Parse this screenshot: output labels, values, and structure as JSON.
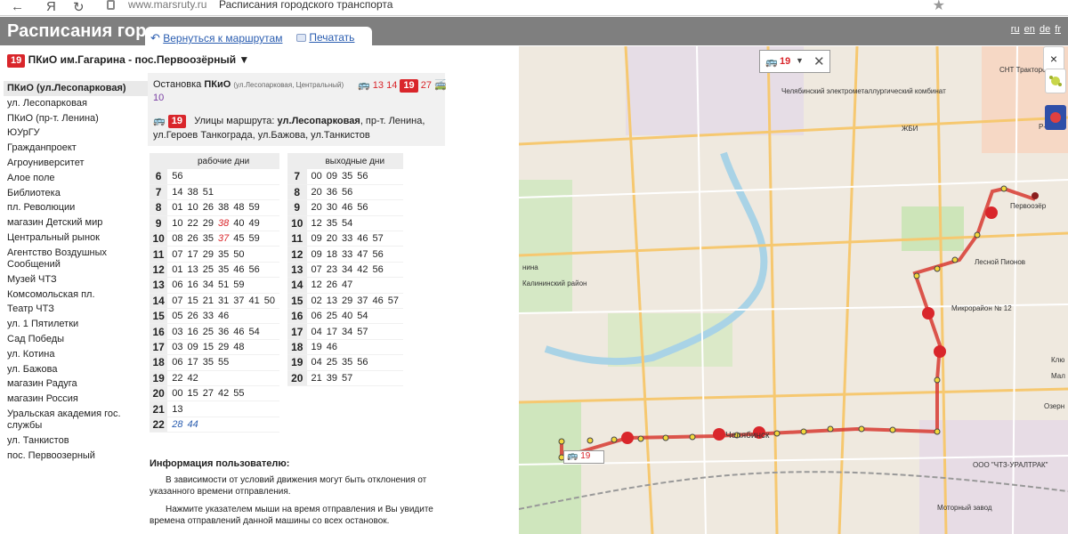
{
  "browser": {
    "domain": "www.marsruty.ru",
    "page_title": "Расписания городского транспорта"
  },
  "header": {
    "site_title": "Расписания гор",
    "languages": [
      "ru",
      "en",
      "de",
      "fr"
    ]
  },
  "tabs": {
    "back_label": "Вернуться к маршрутам",
    "print_label": "Печатать"
  },
  "route": {
    "number": "19",
    "title": "ПКиО им.Гагарина - пос.Первоозёрный ▼"
  },
  "stops": [
    "ПКиО (ул.Лесопарковая)",
    "ул. Лесопарковая",
    "ПКиО (пр-т. Ленина)",
    "ЮУрГУ",
    "Гражданпроект",
    "Агроуниверситет",
    "Алое поле",
    "Библиотека",
    "пл. Революции",
    "магазин Детский мир",
    "Центральный рынок",
    "Агентство Воздушных Сообщений",
    "Музей ЧТЗ",
    "Комсомольская пл.",
    "Театр ЧТЗ",
    "ул. 1 Пятилетки",
    "Сад Победы",
    "ул. Котина",
    "ул. Бажова",
    "магазин Радуга",
    "магазин Россия",
    "Уральская академия гос. службы",
    "ул. Танкистов",
    "пос. Первоозерный"
  ],
  "stop_info": {
    "label": "Остановка",
    "name": "ПКиО",
    "detail": "(ул.Лесопарковая, Центральный)",
    "bus_routes": [
      "13",
      "14"
    ],
    "current_route": "19",
    "bus_routes_after": [
      "27"
    ],
    "trolley_routes": [
      "10"
    ],
    "streets_label": "Улицы маршрута:",
    "streets_bold": "ул.Лесопарковая",
    "streets_rest": ", пр-т. Ленина, ул.Героев Танкограда, ул.Бажова, ул.Танкистов"
  },
  "weekday": {
    "title": "рабочие дни",
    "rows": [
      {
        "h": "6",
        "m": [
          {
            "v": "56"
          }
        ]
      },
      {
        "h": "7",
        "m": [
          {
            "v": "14"
          },
          {
            "v": "38"
          },
          {
            "v": "51"
          }
        ]
      },
      {
        "h": "8",
        "m": [
          {
            "v": "01"
          },
          {
            "v": "10"
          },
          {
            "v": "26"
          },
          {
            "v": "38"
          },
          {
            "v": "48"
          },
          {
            "v": "59"
          }
        ]
      },
      {
        "h": "9",
        "m": [
          {
            "v": "10"
          },
          {
            "v": "22"
          },
          {
            "v": "29"
          },
          {
            "v": "38",
            "c": "r"
          },
          {
            "v": "40"
          },
          {
            "v": "49"
          }
        ]
      },
      {
        "h": "10",
        "m": [
          {
            "v": "08"
          },
          {
            "v": "26"
          },
          {
            "v": "35"
          },
          {
            "v": "37",
            "c": "r"
          },
          {
            "v": "45"
          },
          {
            "v": "59"
          }
        ]
      },
      {
        "h": "11",
        "m": [
          {
            "v": "07"
          },
          {
            "v": "17"
          },
          {
            "v": "29"
          },
          {
            "v": "35"
          },
          {
            "v": "50"
          }
        ]
      },
      {
        "h": "12",
        "m": [
          {
            "v": "01"
          },
          {
            "v": "13"
          },
          {
            "v": "25"
          },
          {
            "v": "35"
          },
          {
            "v": "46"
          },
          {
            "v": "56"
          }
        ]
      },
      {
        "h": "13",
        "m": [
          {
            "v": "06"
          },
          {
            "v": "16"
          },
          {
            "v": "34"
          },
          {
            "v": "51"
          },
          {
            "v": "59"
          }
        ]
      },
      {
        "h": "14",
        "m": [
          {
            "v": "07"
          },
          {
            "v": "15"
          },
          {
            "v": "21"
          },
          {
            "v": "31"
          },
          {
            "v": "37"
          },
          {
            "v": "41"
          },
          {
            "v": "50"
          }
        ]
      },
      {
        "h": "15",
        "m": [
          {
            "v": "05"
          },
          {
            "v": "26"
          },
          {
            "v": "33"
          },
          {
            "v": "46"
          }
        ]
      },
      {
        "h": "16",
        "m": [
          {
            "v": "03"
          },
          {
            "v": "16"
          },
          {
            "v": "25"
          },
          {
            "v": "36"
          },
          {
            "v": "46"
          },
          {
            "v": "54"
          }
        ]
      },
      {
        "h": "17",
        "m": [
          {
            "v": "03"
          },
          {
            "v": "09"
          },
          {
            "v": "15"
          },
          {
            "v": "29"
          },
          {
            "v": "48"
          }
        ]
      },
      {
        "h": "18",
        "m": [
          {
            "v": "06"
          },
          {
            "v": "17"
          },
          {
            "v": "35"
          },
          {
            "v": "55"
          }
        ]
      },
      {
        "h": "19",
        "m": [
          {
            "v": "22"
          },
          {
            "v": "42"
          }
        ]
      },
      {
        "h": "20",
        "m": [
          {
            "v": "00"
          },
          {
            "v": "15"
          },
          {
            "v": "27"
          },
          {
            "v": "42"
          },
          {
            "v": "55"
          }
        ]
      },
      {
        "h": "21",
        "m": [
          {
            "v": "13"
          }
        ]
      },
      {
        "h": "22",
        "m": [
          {
            "v": "28",
            "c": "b"
          },
          {
            "v": "44",
            "c": "b"
          }
        ]
      }
    ]
  },
  "weekend": {
    "title": "выходные дни",
    "rows": [
      {
        "h": "7",
        "m": [
          {
            "v": "00"
          },
          {
            "v": "09"
          },
          {
            "v": "35"
          },
          {
            "v": "56"
          }
        ]
      },
      {
        "h": "8",
        "m": [
          {
            "v": "20"
          },
          {
            "v": "36"
          },
          {
            "v": "56"
          }
        ]
      },
      {
        "h": "9",
        "m": [
          {
            "v": "20"
          },
          {
            "v": "30"
          },
          {
            "v": "46"
          },
          {
            "v": "56"
          }
        ]
      },
      {
        "h": "10",
        "m": [
          {
            "v": "12"
          },
          {
            "v": "35"
          },
          {
            "v": "54"
          }
        ]
      },
      {
        "h": "11",
        "m": [
          {
            "v": "09"
          },
          {
            "v": "20"
          },
          {
            "v": "33"
          },
          {
            "v": "46"
          },
          {
            "v": "57"
          }
        ]
      },
      {
        "h": "12",
        "m": [
          {
            "v": "09"
          },
          {
            "v": "18"
          },
          {
            "v": "33"
          },
          {
            "v": "47"
          },
          {
            "v": "56"
          }
        ]
      },
      {
        "h": "13",
        "m": [
          {
            "v": "07"
          },
          {
            "v": "23"
          },
          {
            "v": "34"
          },
          {
            "v": "42"
          },
          {
            "v": "56"
          }
        ]
      },
      {
        "h": "14",
        "m": [
          {
            "v": "12"
          },
          {
            "v": "26"
          },
          {
            "v": "47"
          }
        ]
      },
      {
        "h": "15",
        "m": [
          {
            "v": "02"
          },
          {
            "v": "13"
          },
          {
            "v": "29"
          },
          {
            "v": "37"
          },
          {
            "v": "46"
          },
          {
            "v": "57"
          }
        ]
      },
      {
        "h": "16",
        "m": [
          {
            "v": "06"
          },
          {
            "v": "25"
          },
          {
            "v": "40"
          },
          {
            "v": "54"
          }
        ]
      },
      {
        "h": "17",
        "m": [
          {
            "v": "04"
          },
          {
            "v": "17"
          },
          {
            "v": "34"
          },
          {
            "v": "57"
          }
        ]
      },
      {
        "h": "18",
        "m": [
          {
            "v": "19"
          },
          {
            "v": "46"
          }
        ]
      },
      {
        "h": "19",
        "m": [
          {
            "v": "04"
          },
          {
            "v": "25"
          },
          {
            "v": "35"
          },
          {
            "v": "56"
          }
        ]
      },
      {
        "h": "20",
        "m": [
          {
            "v": "21"
          },
          {
            "v": "39"
          },
          {
            "v": "57"
          }
        ]
      }
    ]
  },
  "user_info": {
    "title": "Информация пользователю:",
    "p1": "В зависимости от условий движения могут быть отклонения от указанного времени отправления.",
    "p2": "Нажмите указателем мыши на время отправления и Вы увидите времена отправлений данной машины со всех остановок."
  },
  "map": {
    "route_number": "19",
    "colors": {
      "route": "#d73a31",
      "stop_dot": "#f3d83b",
      "bus": "#d9262b",
      "trolley": "#7a3fa3",
      "link": "#2a5db0"
    },
    "labels": [
      "Челябинский электрометаллургический комбинат",
      "Калининский район",
      "Первоозёр",
      "Челябинск",
      "ООО \"ЧТЗ-УРАЛТРАК\"",
      "Микрорайон № 12",
      "Моторный завод",
      "СНТ Тракторо",
      "Р-254",
      "Озерн",
      "Клю",
      "Мал",
      "ЖБИ",
      "Лесной Пионов",
      "нина"
    ]
  }
}
